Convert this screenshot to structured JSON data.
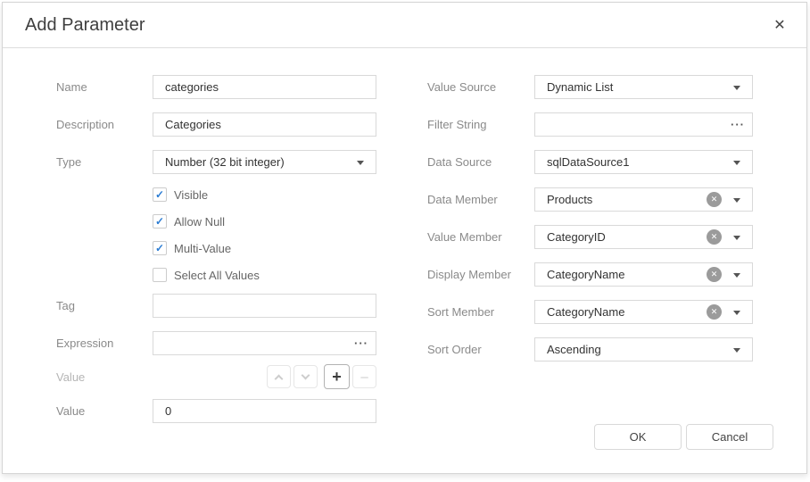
{
  "dialog": {
    "title": "Add Parameter"
  },
  "icons": {
    "close": "✕",
    "check": "✓",
    "clear": "✕",
    "ellipsis": "···",
    "plus": "+",
    "minus": "–"
  },
  "colors": {
    "accent_blue": "#2b7cd3",
    "label_gray": "#8a8a8a",
    "border_gray": "#d9d9d9",
    "clear_icon_gray": "#9b9b9b"
  },
  "left": {
    "name": {
      "label": "Name",
      "value": "categories"
    },
    "description": {
      "label": "Description",
      "value": "Categories"
    },
    "type": {
      "label": "Type",
      "value": "Number (32 bit integer)"
    },
    "checkboxes": [
      {
        "label": "Visible",
        "checked": true
      },
      {
        "label": "Allow Null",
        "checked": true
      },
      {
        "label": "Multi-Value",
        "checked": true
      },
      {
        "label": "Select All Values",
        "checked": false
      }
    ],
    "tag": {
      "label": "Tag",
      "value": ""
    },
    "expression": {
      "label": "Expression",
      "value": ""
    },
    "value_stepper": {
      "label": "Value"
    },
    "value": {
      "label": "Value",
      "value": "0"
    }
  },
  "right": {
    "value_source": {
      "label": "Value Source",
      "value": "Dynamic List"
    },
    "filter_string": {
      "label": "Filter String",
      "value": ""
    },
    "data_source": {
      "label": "Data Source",
      "value": "sqlDataSource1"
    },
    "data_member": {
      "label": "Data Member",
      "value": "Products"
    },
    "value_member": {
      "label": "Value Member",
      "value": "CategoryID"
    },
    "display_member": {
      "label": "Display Member",
      "value": "CategoryName"
    },
    "sort_member": {
      "label": "Sort Member",
      "value": "CategoryName"
    },
    "sort_order": {
      "label": "Sort Order",
      "value": "Ascending"
    }
  },
  "footer": {
    "ok_label": "OK",
    "cancel_label": "Cancel"
  }
}
